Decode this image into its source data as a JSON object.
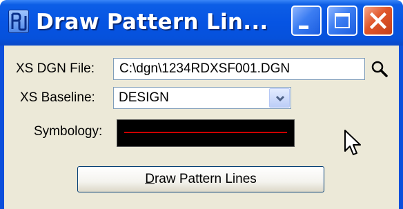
{
  "window": {
    "title": "Draw Pattern Lin...",
    "controls": {
      "minimize_icon": "minimize-icon",
      "maximize_icon": "maximize-icon",
      "close_icon": "close-icon"
    }
  },
  "form": {
    "xs_dgn_file": {
      "label": "XS DGN File:",
      "value": "C:\\dgn\\1234RDXSF001.DGN",
      "browse_icon": "search-icon"
    },
    "xs_baseline": {
      "label": "XS Baseline:",
      "selected": "DESIGN"
    },
    "symbology": {
      "label": "Symbology:",
      "background_color": "#000000",
      "line_color": "#cc0000"
    }
  },
  "action_button": {
    "label_accel": "D",
    "label_rest": "raw Pattern Lines"
  },
  "colors": {
    "titlebar": "#0654e3",
    "close_button": "#e0562a",
    "dialog_face": "#ece9d8"
  }
}
